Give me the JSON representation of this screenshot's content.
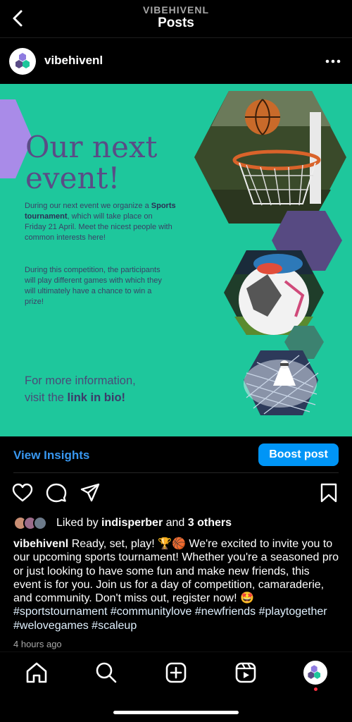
{
  "header": {
    "account_label": "VIBEHIVENL",
    "title": "Posts"
  },
  "post": {
    "username": "vibehivenl",
    "image": {
      "title_line1": "Our next",
      "title_line2": "event!",
      "desc_part1": "During our next event we organize a ",
      "desc_bold": "Sports tournament",
      "desc_part2": ", which will take place on Friday 21 April. Meet the nicest people with common interests here!",
      "desc_para2": "During this competition, the participants will play different games with which they will ultimately have a chance to win a prize!",
      "more_info_line1": "For more information,",
      "more_info_prefix": "visit the ",
      "more_info_bold": "link in bio!"
    },
    "view_insights_label": "View Insights",
    "boost_label": "Boost post",
    "liked_prefix": "Liked by ",
    "liked_user": "indisperber",
    "liked_mid": " and ",
    "liked_others": "3 others",
    "caption_user": "vibehivenl",
    "caption_text": " Ready, set, play! 🏆🏀 We're excited to invite you to our upcoming sports tournament! Whether you're a seasoned pro or just looking to have some fun and make new friends, this event is for you. Join us for a day of competition, camaraderie, and community. Don't miss out, register now! 🤩 ",
    "caption_tags": "#sportstournament #communitylove #newfriends #playtogether #welovegames #scaleup",
    "time_ago": "4 hours ago"
  },
  "colors": {
    "accent_teal": "#1ec79c",
    "purple": "#5a4c86",
    "link_blue": "#3897f0",
    "button_blue": "#0095f6"
  },
  "icons": [
    "back-chevron-icon",
    "more-dots-icon",
    "heart-icon",
    "comment-icon",
    "share-icon",
    "bookmark-icon",
    "home-icon",
    "search-icon",
    "create-icon",
    "reels-icon",
    "profile-avatar-icon"
  ]
}
